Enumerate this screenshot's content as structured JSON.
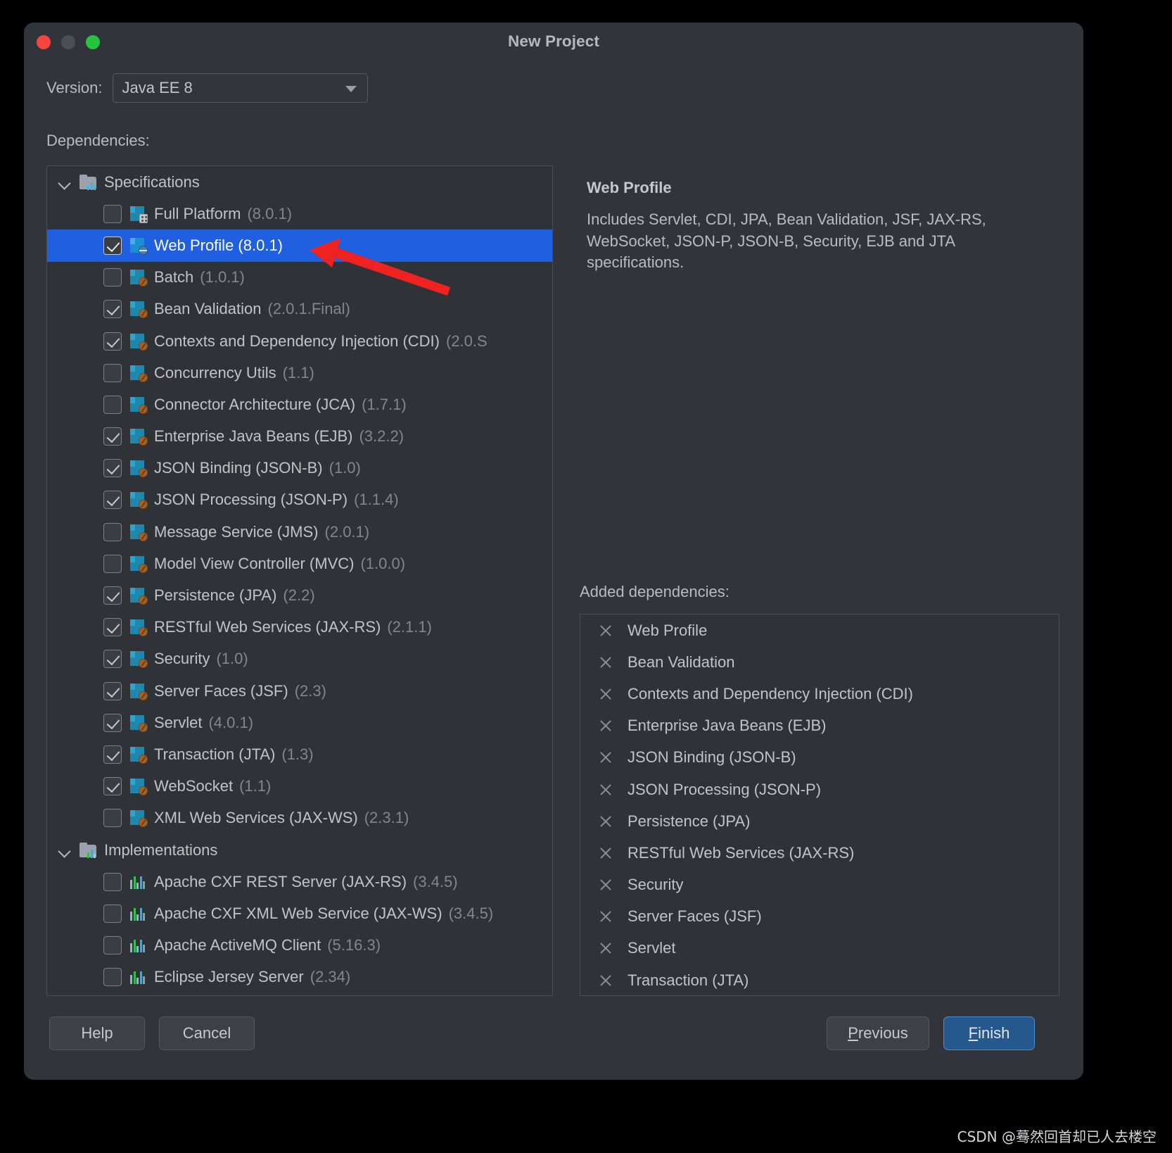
{
  "window": {
    "title": "New Project",
    "traffic_lights": [
      "close-red",
      "minimize-yellow",
      "zoom-green"
    ]
  },
  "version": {
    "label": "Version:",
    "selected": "Java EE 8"
  },
  "dependencies_label": "Dependencies:",
  "tree": {
    "groups": [
      {
        "name": "Specifications",
        "icon": "folder-specifications-icon",
        "expanded": true,
        "items": [
          {
            "label": "Full Platform",
            "version": "(8.0.1)",
            "checked": false,
            "selected": false,
            "icon": "spec-full-icon"
          },
          {
            "label": "Web Profile (8.0.1)",
            "version": "",
            "checked": true,
            "selected": true,
            "icon": "spec-web-icon"
          },
          {
            "label": "Batch",
            "version": "(1.0.1)",
            "checked": false,
            "selected": false,
            "icon": "spec-icon"
          },
          {
            "label": "Bean Validation",
            "version": "(2.0.1.Final)",
            "checked": true,
            "selected": false,
            "icon": "spec-icon"
          },
          {
            "label": "Contexts and Dependency Injection (CDI)",
            "version": "(2.0.S",
            "checked": true,
            "selected": false,
            "icon": "spec-icon"
          },
          {
            "label": "Concurrency Utils",
            "version": "(1.1)",
            "checked": false,
            "selected": false,
            "icon": "spec-icon"
          },
          {
            "label": "Connector Architecture (JCA)",
            "version": "(1.7.1)",
            "checked": false,
            "selected": false,
            "icon": "spec-icon"
          },
          {
            "label": "Enterprise Java Beans (EJB)",
            "version": "(3.2.2)",
            "checked": true,
            "selected": false,
            "icon": "spec-icon"
          },
          {
            "label": "JSON Binding (JSON-B)",
            "version": "(1.0)",
            "checked": true,
            "selected": false,
            "icon": "spec-icon"
          },
          {
            "label": "JSON Processing (JSON-P)",
            "version": "(1.1.4)",
            "checked": true,
            "selected": false,
            "icon": "spec-icon"
          },
          {
            "label": "Message Service (JMS)",
            "version": "(2.0.1)",
            "checked": false,
            "selected": false,
            "icon": "spec-icon"
          },
          {
            "label": "Model View Controller (MVC)",
            "version": "(1.0.0)",
            "checked": false,
            "selected": false,
            "icon": "spec-icon"
          },
          {
            "label": "Persistence (JPA)",
            "version": "(2.2)",
            "checked": true,
            "selected": false,
            "icon": "spec-icon"
          },
          {
            "label": "RESTful Web Services (JAX-RS)",
            "version": "(2.1.1)",
            "checked": true,
            "selected": false,
            "icon": "spec-icon"
          },
          {
            "label": "Security",
            "version": "(1.0)",
            "checked": true,
            "selected": false,
            "icon": "spec-icon"
          },
          {
            "label": "Server Faces (JSF)",
            "version": "(2.3)",
            "checked": true,
            "selected": false,
            "icon": "spec-icon"
          },
          {
            "label": "Servlet",
            "version": "(4.0.1)",
            "checked": true,
            "selected": false,
            "icon": "spec-icon"
          },
          {
            "label": "Transaction (JTA)",
            "version": "(1.3)",
            "checked": true,
            "selected": false,
            "icon": "spec-icon"
          },
          {
            "label": "WebSocket",
            "version": "(1.1)",
            "checked": true,
            "selected": false,
            "icon": "spec-icon"
          },
          {
            "label": "XML Web Services (JAX-WS)",
            "version": "(2.3.1)",
            "checked": false,
            "selected": false,
            "icon": "spec-icon"
          }
        ]
      },
      {
        "name": "Implementations",
        "icon": "folder-implementations-icon",
        "expanded": true,
        "items": [
          {
            "label": "Apache CXF REST Server (JAX-RS)",
            "version": "(3.4.5)",
            "checked": false,
            "selected": false,
            "icon": "impl-icon"
          },
          {
            "label": "Apache CXF XML Web Service (JAX-WS)",
            "version": "(3.4.5)",
            "checked": false,
            "selected": false,
            "icon": "impl-icon"
          },
          {
            "label": "Apache ActiveMQ Client",
            "version": "(5.16.3)",
            "checked": false,
            "selected": false,
            "icon": "impl-icon"
          },
          {
            "label": "Eclipse Jersey Server",
            "version": "(2.34)",
            "checked": false,
            "selected": false,
            "icon": "impl-icon"
          }
        ]
      }
    ]
  },
  "detail": {
    "title": "Web Profile",
    "description": "Includes Servlet, CDI, JPA, Bean Validation, JSF, JAX-RS, WebSocket, JSON-P, JSON-B, Security, EJB and JTA specifications."
  },
  "added": {
    "label": "Added dependencies:",
    "items": [
      "Web Profile",
      "Bean Validation",
      "Contexts and Dependency Injection (CDI)",
      "Enterprise Java Beans (EJB)",
      "JSON Binding (JSON-B)",
      "JSON Processing (JSON-P)",
      "Persistence (JPA)",
      "RESTful Web Services (JAX-RS)",
      "Security",
      "Server Faces (JSF)",
      "Servlet",
      "Transaction (JTA)"
    ]
  },
  "buttons": {
    "help": "Help",
    "cancel": "Cancel",
    "previous_mnemonic": "P",
    "previous_rest": "revious",
    "finish_mnemonic": "F",
    "finish_rest": "inish"
  },
  "annotation": {
    "arrow": "red-pointer-arrow",
    "arrow_color": "#ef2222"
  },
  "watermark": "CSDN @蓦然回首却已人去楼空",
  "colors": {
    "window_bg": "#31343a",
    "panel_bg": "#2f3237",
    "selection_blue": "#1f5fe0",
    "finish_blue": "#25588c",
    "text": "#c1c3c6",
    "muted_text": "#83878c"
  }
}
